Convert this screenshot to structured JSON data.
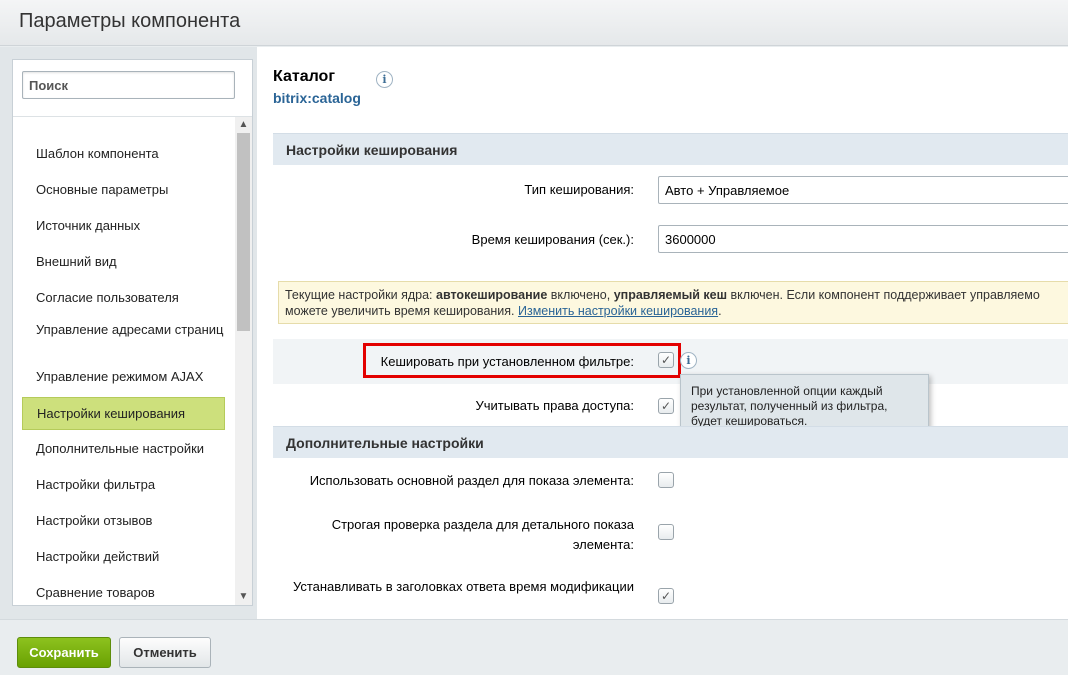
{
  "window": {
    "title": "Параметры компонента"
  },
  "sidebar": {
    "search_placeholder": "Поиск",
    "items": [
      {
        "label": "Шаблон компонента"
      },
      {
        "label": "Основные параметры"
      },
      {
        "label": "Источник данных"
      },
      {
        "label": "Внешний вид"
      },
      {
        "label": "Согласие пользователя"
      },
      {
        "label": "Управление адресами страниц"
      },
      {
        "label": "Управление режимом AJAX"
      },
      {
        "label": "Настройки кеширования",
        "active": true
      },
      {
        "label": "Дополнительные настройки"
      },
      {
        "label": "Настройки фильтра"
      },
      {
        "label": "Настройки отзывов"
      },
      {
        "label": "Настройки действий"
      },
      {
        "label": "Сравнение товаров"
      }
    ]
  },
  "component": {
    "title": "Каталог",
    "code": "bitrix:catalog"
  },
  "cache_section": {
    "heading": "Настройки кеширования",
    "cache_type_label": "Тип кеширования:",
    "cache_type_value": "Авто + Управляемое",
    "cache_time_label": "Время кеширования (сек.):",
    "cache_time_value": "3600000",
    "note": {
      "part1": "Текущие настройки ядра: ",
      "bold1": "автокеширование",
      "part2": " включено, ",
      "bold2": "управляемый кеш",
      "part3": " включен. Если компонент поддерживает управляемо",
      "line2": "можете увеличить время кеширования. ",
      "link": "Изменить настройки кеширования",
      "end": "."
    },
    "cache_filter_label": "Кешировать при установленном фильтре:",
    "cache_filter_checked": true,
    "access_rights_label": "Учитывать права доступа:",
    "access_rights_checked": true
  },
  "tooltip": {
    "line1": "При установленной опции каждый",
    "line2": "результат, полученный из фильтра,",
    "line3": "будет кешироваться."
  },
  "extra_section": {
    "heading": "Дополнительные настройки",
    "use_main_section_label": "Использовать основной раздел для показа элемента:",
    "use_main_section_checked": false,
    "strict_check_label_line1": "Строгая проверка раздела для детального показа",
    "strict_check_label_line2": "элемента:",
    "strict_check_checked": false,
    "last_modified_label": "Устанавливать в заголовках ответа время модификации",
    "last_modified_checked": true
  },
  "footer": {
    "save_label": "Сохранить",
    "cancel_label": "Отменить"
  },
  "colors": {
    "accent_green": "#7ab513",
    "active_item": "#cde07c",
    "link": "#2a6496",
    "highlight": "#e30000"
  }
}
